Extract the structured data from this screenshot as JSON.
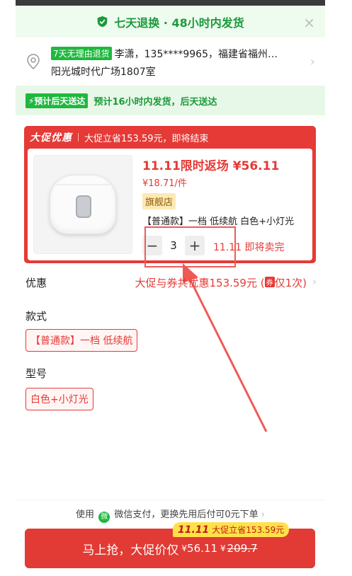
{
  "guarantee": {
    "text": "七天退换 · 48小时内发货",
    "close": "×"
  },
  "address": {
    "tag": "7天无理由退货",
    "line1": "李潇，135****9965，福建省福州…",
    "line2": "阳光城时代广场1807室"
  },
  "delivery": {
    "badge": "⚡预计后天送达",
    "text": "预计16小时内发货，后天送达"
  },
  "promo": {
    "logo": "大促优惠",
    "save": "大促立省153.59元，即将结束",
    "title": "11.11限时返场 ¥56.11",
    "unit_price": "¥18.71/件",
    "store_tag": "旗舰店",
    "variant": "【普通款】一档 低续航 白色+小灯光",
    "quantity": "3",
    "minus": "−",
    "plus": "+",
    "soldout": "11.11 即将卖完"
  },
  "discount": {
    "label": "优惠",
    "value": "大促与券共优惠153.59元 (",
    "icon": "券",
    "tail": "仅1次)"
  },
  "style": {
    "title": "款式",
    "option": "【普通款】一档 低续航"
  },
  "model": {
    "title": "型号",
    "option": "白色+小灯光"
  },
  "pay": {
    "prefix": "使用",
    "wx_icon": "微",
    "text": "微信支付，更换先用后付可0元下单",
    "chev": "›"
  },
  "buy": {
    "tag_strong": "11.11",
    "tag_text": "大促立省153.59元",
    "label": "马上抢，大促价仅",
    "price_sym": "¥",
    "price": "56.11",
    "orig_sym": "¥",
    "orig": "209.7"
  },
  "colors": {
    "accent_red": "#e53a36",
    "green": "#1fb83e"
  }
}
